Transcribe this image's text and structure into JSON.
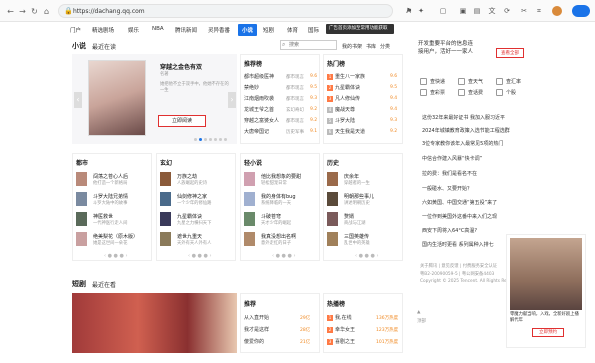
{
  "browser": {
    "url": "https://dachang.qq.com",
    "lock_icon": "lock-icon"
  },
  "nav": {
    "items": [
      "门户",
      "精选剧场",
      "娱乐",
      "NBA",
      "腾讯新闻",
      "灵异香番",
      "小说",
      "短剧",
      "体育",
      "国际"
    ],
    "active": "小说",
    "lang_tip": "广告首页添加至常用功能获取"
  },
  "section1": {
    "title": "小说",
    "subtitle": "最近在读",
    "search_placeholder": "搜索",
    "links": [
      "我的书架",
      "书库",
      "分类"
    ],
    "arrow_left": "‹",
    "arrow_right": "›"
  },
  "featured": {
    "title": "穿越之金色有双",
    "author": "名著",
    "desc": "她把他不立于双手中，他她不存在的一生",
    "read_btn": "立即阅读",
    "cover_text": "金色有双"
  },
  "recommend": {
    "title": "推荐榜",
    "items": [
      {
        "name": "都市超级医神",
        "cat": "都市现言",
        "num": "9.6"
      },
      {
        "name": "禁绝妙",
        "cat": "都市现言",
        "num": "9.5"
      },
      {
        "name": "江南烟雨吹袭",
        "cat": "都市现言",
        "num": "9.3"
      },
      {
        "name": "龙城王爷之首",
        "cat": "玄幻奇幻",
        "num": "9.2"
      },
      {
        "name": "穿越之富婆女人",
        "cat": "都市现言",
        "num": "9.2"
      },
      {
        "name": "大唐帝国记",
        "cat": "历史军事",
        "num": "9.1"
      }
    ]
  },
  "hot": {
    "title": "热门榜",
    "items": [
      {
        "name": "重生八一家族",
        "num": "9.6"
      },
      {
        "name": "九星霸体诀",
        "num": "9.5"
      },
      {
        "name": "凡人修仙传",
        "num": "9.4"
      },
      {
        "name": "魔战天尊",
        "num": "9.4"
      },
      {
        "name": "斗罗大陆",
        "num": "9.3"
      },
      {
        "name": "天生我是天道",
        "num": "9.2"
      }
    ]
  },
  "categories": [
    {
      "title": "都市",
      "books": [
        {
          "t": "闯荡之苍心人后",
          "d": "他打造一个新格局"
        },
        {
          "t": "斗罗大陆兄弟情",
          "d": "斗罗大陆中的故事"
        },
        {
          "t": "神医救世",
          "d": "一代神医行走人间"
        },
        {
          "t": "绝美梨花（原木版）",
          "d": "她是这世间一朵花"
        }
      ]
    },
    {
      "title": "玄幻",
      "books": [
        {
          "t": "万族之劫",
          "d": "人族崛起的史诗"
        },
        {
          "t": "仙剑修神之家",
          "d": "一个少年的修仙路"
        },
        {
          "t": "九星霸体诀",
          "d": "九星之力横扫天下"
        },
        {
          "t": "遮世九重天",
          "d": "天外有天人外有人"
        }
      ]
    },
    {
      "title": "轻小说",
      "books": [
        {
          "t": "他比我想象的要甜",
          "d": "轻松甜宠日常"
        },
        {
          "t": "我的身体有bug",
          "d": "系统降临的一天"
        },
        {
          "t": "斗破苍穹",
          "d": "天才少年的崛起"
        },
        {
          "t": "我真没想出名啊",
          "d": "意外走红的日子"
        }
      ]
    },
    {
      "title": "历史",
      "books": [
        {
          "t": "庆余年",
          "d": "穿越者的一生"
        },
        {
          "t": "明朝那些事儿",
          "d": "讲述明朝历史"
        },
        {
          "t": "赘婿",
          "d": "商战与江湖"
        },
        {
          "t": "三国英雄传",
          "d": "乱世中的英雄"
        }
      ]
    }
  ],
  "section2": {
    "title": "短剧",
    "subtitle": "最近在看"
  },
  "drama_recommend": {
    "title": "推荐",
    "items": [
      {
        "name": "从入直开始",
        "num": "29亿"
      },
      {
        "name": "我才是这样",
        "num": "28亿"
      },
      {
        "name": "傻爱你的",
        "num": "21亿"
      }
    ]
  },
  "drama_hot": {
    "title": "热播榜",
    "items": [
      {
        "name": "我,在线",
        "num": "136万热度"
      },
      {
        "name": "幸华女王",
        "num": "123万热度"
      },
      {
        "name": "喜剧之王",
        "num": "101万热度"
      }
    ]
  },
  "sidebar": {
    "top_text": "开发重要平台的信息连接用户，活好一一家人",
    "top_btn": "查看全部",
    "tools": [
      "查快递",
      "查天气",
      "查汇率",
      "查彩票",
      "查话费",
      "个股"
    ],
    "news": [
      "这份32年来最好证书 我加入服习近平",
      "2024年城镇教育政策入选节能工程选群",
      "3位专家教你该年入最常见5项的热门",
      "中信合作建入风暴“快卡调”",
      "拉的费：我们是看名不在",
      "一般碰水、又要开始？",
      "六如黄国、中国交通“第五役”来了",
      "一位作到美国外这番中来入们之现",
      "西安下周将入64°C高温?",
      "国内生活时更看 系列属种入排七"
    ],
    "footer": [
      "关于腾讯 | 意见反馈 | 付费服务安全认证",
      "粤B2-20090059-5 | 粤公网安备4403",
      "Copyright © 2025 Tencent. All Rights Reserved."
    ],
    "back_top": "顶部"
  },
  "ad": {
    "text": "零魔力献当响，入戏，全新好剧上播解代年",
    "btn": "立即预约"
  }
}
